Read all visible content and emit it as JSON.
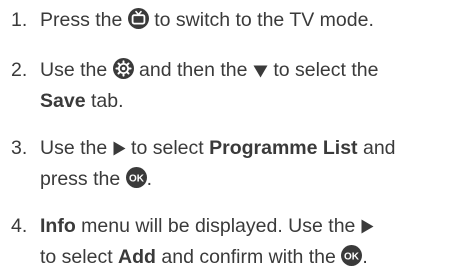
{
  "steps": [
    {
      "number": "1.",
      "p1": "Press the",
      "icon1": "tv-mode-button-icon",
      "p2": "to switch to the TV mode."
    },
    {
      "number": "2.",
      "p1": "Use the",
      "icon1": "settings-gear-button-icon",
      "p2": "and then the",
      "icon2": "down-arrow-icon",
      "p3": "to select the",
      "bold1": "Save",
      "p4": "tab."
    },
    {
      "number": "3.",
      "p1": "Use the",
      "icon1": "right-arrow-icon",
      "p2": "to select",
      "bold1": "Programme List",
      "p3": "and",
      "p4": "press the",
      "icon2": "ok-button-icon",
      "p5": "."
    },
    {
      "number": "4.",
      "bold1": "Info",
      "p1": "menu will be displayed. Use the",
      "icon1": "right-arrow-icon",
      "p2": "to select",
      "bold2": "Add",
      "p3": "and confirm with the",
      "icon2": "ok-button-icon",
      "p4": "."
    }
  ],
  "colors": {
    "text": "#3a3a3a",
    "icon": "#3a3a3a",
    "icon_fg": "#ffffff"
  }
}
